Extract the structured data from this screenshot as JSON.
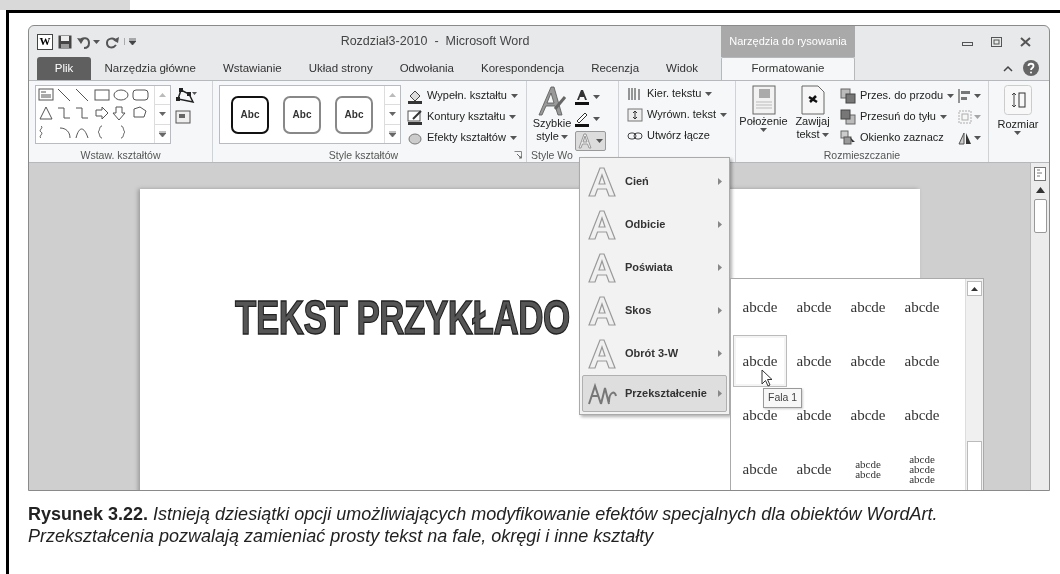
{
  "window": {
    "app_icon": "W",
    "title": "Rozdział3-2010  -  Microsoft Word",
    "context_group": "Narzędzia do rysowania"
  },
  "tabs": [
    {
      "label": "Plik",
      "kind": "file",
      "selected": false
    },
    {
      "label": "Narzędzia główne",
      "kind": "normal",
      "selected": false
    },
    {
      "label": "Wstawianie",
      "kind": "normal",
      "selected": false
    },
    {
      "label": "Układ strony",
      "kind": "normal",
      "selected": false
    },
    {
      "label": "Odwołania",
      "kind": "normal",
      "selected": false
    },
    {
      "label": "Korespondencja",
      "kind": "normal",
      "selected": false
    },
    {
      "label": "Recenzja",
      "kind": "normal",
      "selected": false
    },
    {
      "label": "Widok",
      "kind": "normal",
      "selected": false
    },
    {
      "label": "Formatowanie",
      "kind": "context",
      "selected": true
    }
  ],
  "ribbon": {
    "groups": [
      {
        "kind": "shapes",
        "label": "Wstaw. kształtów"
      },
      {
        "kind": "shape_styles",
        "label": "Style kształtów",
        "presets": [
          "Abc",
          "Abc",
          "Abc"
        ],
        "commands": [
          {
            "label": "Wypełn. kształtu",
            "dropdown": true
          },
          {
            "label": "Kontury kształtu",
            "dropdown": true
          },
          {
            "label": "Efekty kształtów",
            "dropdown": true
          }
        ]
      },
      {
        "kind": "wordart_styles",
        "label": "Style Wo",
        "quick_styles": [
          "Szybkie",
          "style"
        ]
      },
      {
        "kind": "text",
        "commands": [
          {
            "label": "Kier. tekstu",
            "dropdown": true
          },
          {
            "label": "Wyrówn. tekst",
            "dropdown": true
          },
          {
            "label": "Utwórz łącze",
            "dropdown": false
          }
        ]
      },
      {
        "kind": "arrange",
        "label": "Rozmieszczanie",
        "large": [
          {
            "lines": [
              "Położenie"
            ]
          },
          {
            "lines": [
              "Zawijaj",
              "tekst"
            ]
          }
        ],
        "commands": [
          {
            "label": "Przes. do przodu",
            "dropdown": true
          },
          {
            "label": "Przesuń do tyłu",
            "dropdown": true
          },
          {
            "label": "Okienko zaznacz",
            "dropdown": false
          }
        ]
      },
      {
        "kind": "size",
        "label_button": "Rozmiar"
      }
    ]
  },
  "document": {
    "wordart": "TEKST PRZYKŁADO"
  },
  "effects_menu": {
    "open": true,
    "items": [
      {
        "label": "Cień",
        "selected": false
      },
      {
        "label": "Odbicie",
        "selected": false
      },
      {
        "label": "Poświata",
        "selected": false
      },
      {
        "label": "Skos",
        "selected": false
      },
      {
        "label": "Obrót 3-W",
        "selected": false
      },
      {
        "label": "Przekształcenie",
        "selected": true
      }
    ]
  },
  "transform_gallery": {
    "tooltip": "Fala 1",
    "rows": [
      [
        {
          "lines": [
            "abcde"
          ],
          "hovered": false
        },
        {
          "lines": [
            "abcde"
          ],
          "hovered": false
        },
        {
          "lines": [
            "abcde"
          ],
          "hovered": false
        },
        {
          "lines": [
            "abcde"
          ],
          "hovered": false
        }
      ],
      [
        {
          "lines": [
            "abcde"
          ],
          "hovered": true
        },
        {
          "lines": [
            "abcde"
          ],
          "hovered": false
        },
        {
          "lines": [
            "abcde"
          ],
          "hovered": false
        },
        {
          "lines": [
            "abcde"
          ],
          "hovered": false
        }
      ],
      [
        {
          "lines": [
            "abcde"
          ],
          "hovered": false
        },
        {
          "lines": [
            "abcde"
          ],
          "hovered": false
        },
        {
          "lines": [
            "abcde"
          ],
          "hovered": false
        },
        {
          "lines": [
            "abcde"
          ],
          "hovered": false
        }
      ],
      [
        {
          "lines": [
            "abcde"
          ],
          "hovered": false
        },
        {
          "lines": [
            "abcde"
          ],
          "hovered": false
        },
        {
          "lines": [
            "abcde",
            "abcde"
          ],
          "hovered": false
        },
        {
          "lines": [
            "abcde",
            "abcde",
            "abcde"
          ],
          "hovered": false
        }
      ]
    ]
  },
  "caption": "**Rysunek 3.22.** Istnieją dziesiątki opcji umożliwiających modyfikowanie efektów specjalnych dla obiektów WordArt. Przekształcenia pozwalają zamieniać prosty tekst na fale, okręgi i inne kształty"
}
